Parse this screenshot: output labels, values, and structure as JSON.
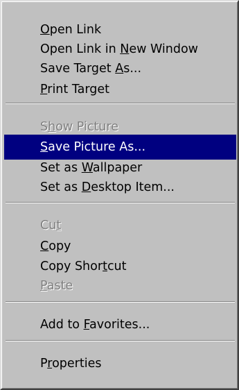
{
  "menu": {
    "items": [
      {
        "pre": "",
        "acc": "O",
        "post": "pen Link"
      },
      {
        "pre": "Open Link in ",
        "acc": "N",
        "post": "ew Window"
      },
      {
        "pre": "Save Target ",
        "acc": "A",
        "post": "s..."
      },
      {
        "pre": "",
        "acc": "P",
        "post": "rint Target"
      },
      {
        "pre": "S",
        "acc": "h",
        "post": "ow Picture"
      },
      {
        "pre": "",
        "acc": "S",
        "post": "ave Picture As..."
      },
      {
        "pre": "Set as ",
        "acc": "W",
        "post": "allpaper"
      },
      {
        "pre": "Set as ",
        "acc": "D",
        "post": "esktop Item..."
      },
      {
        "pre": "Cu",
        "acc": "t",
        "post": ""
      },
      {
        "pre": "",
        "acc": "C",
        "post": "opy"
      },
      {
        "pre": "Copy Shor",
        "acc": "t",
        "post": "cut"
      },
      {
        "pre": "",
        "acc": "P",
        "post": "aste"
      },
      {
        "pre": "Add to ",
        "acc": "F",
        "post": "avorites..."
      },
      {
        "pre": "P",
        "acc": "r",
        "post": "operties"
      }
    ]
  },
  "colors": {
    "menu_face": "#c0c0c0",
    "highlight": "#000080",
    "highlight_text": "#ffffff",
    "disabled_text": "#808080"
  }
}
